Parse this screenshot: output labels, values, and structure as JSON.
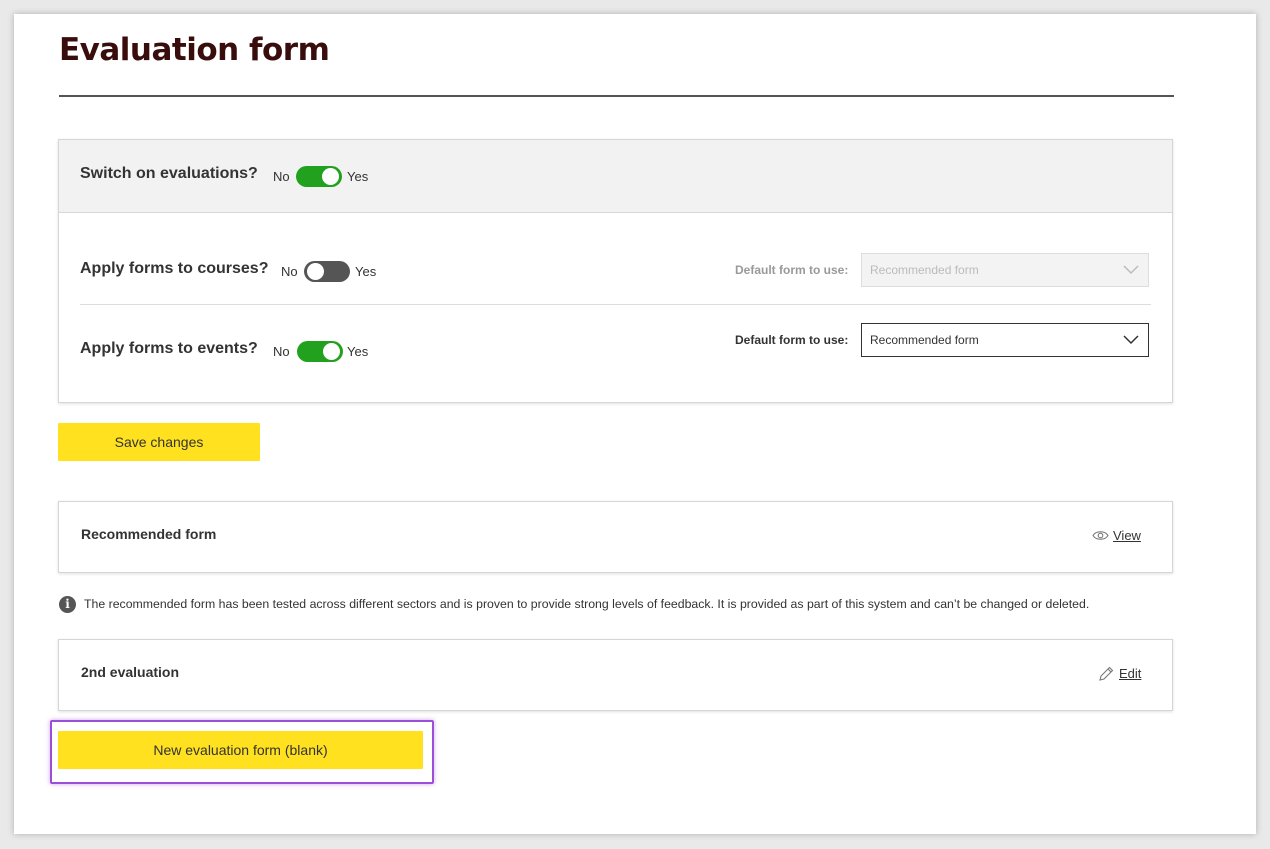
{
  "page": {
    "title": "Evaluation form"
  },
  "settings": {
    "switch_on": {
      "label": "Switch on evaluations?",
      "no": "No",
      "yes": "Yes",
      "state": "on"
    },
    "courses": {
      "label": "Apply forms to courses?",
      "no": "No",
      "yes": "Yes",
      "state": "off",
      "default_label": "Default form to use:",
      "default_value": "Recommended form",
      "select_enabled": false
    },
    "events": {
      "label": "Apply forms to events?",
      "no": "No",
      "yes": "Yes",
      "state": "on",
      "default_label": "Default form to use:",
      "default_value": "Recommended form",
      "select_enabled": true
    }
  },
  "save_button": "Save changes",
  "forms": [
    {
      "name": "Recommended form",
      "action": "View",
      "action_icon": "eye-icon"
    },
    {
      "name": "2nd evaluation",
      "action": "Edit",
      "action_icon": "pencil-icon"
    }
  ],
  "info_note": "The recommended form has been tested across different sectors and is proven to provide strong levels of feedback. It is provided as part of this system and can’t be changed or deleted.",
  "new_form_button": "New evaluation form (blank)",
  "colors": {
    "toggle_on": "#22a11f",
    "toggle_off": "#555555",
    "button_yellow": "#ffe11f",
    "title": "#3a0d0d",
    "highlight": "#9b4fd8"
  }
}
